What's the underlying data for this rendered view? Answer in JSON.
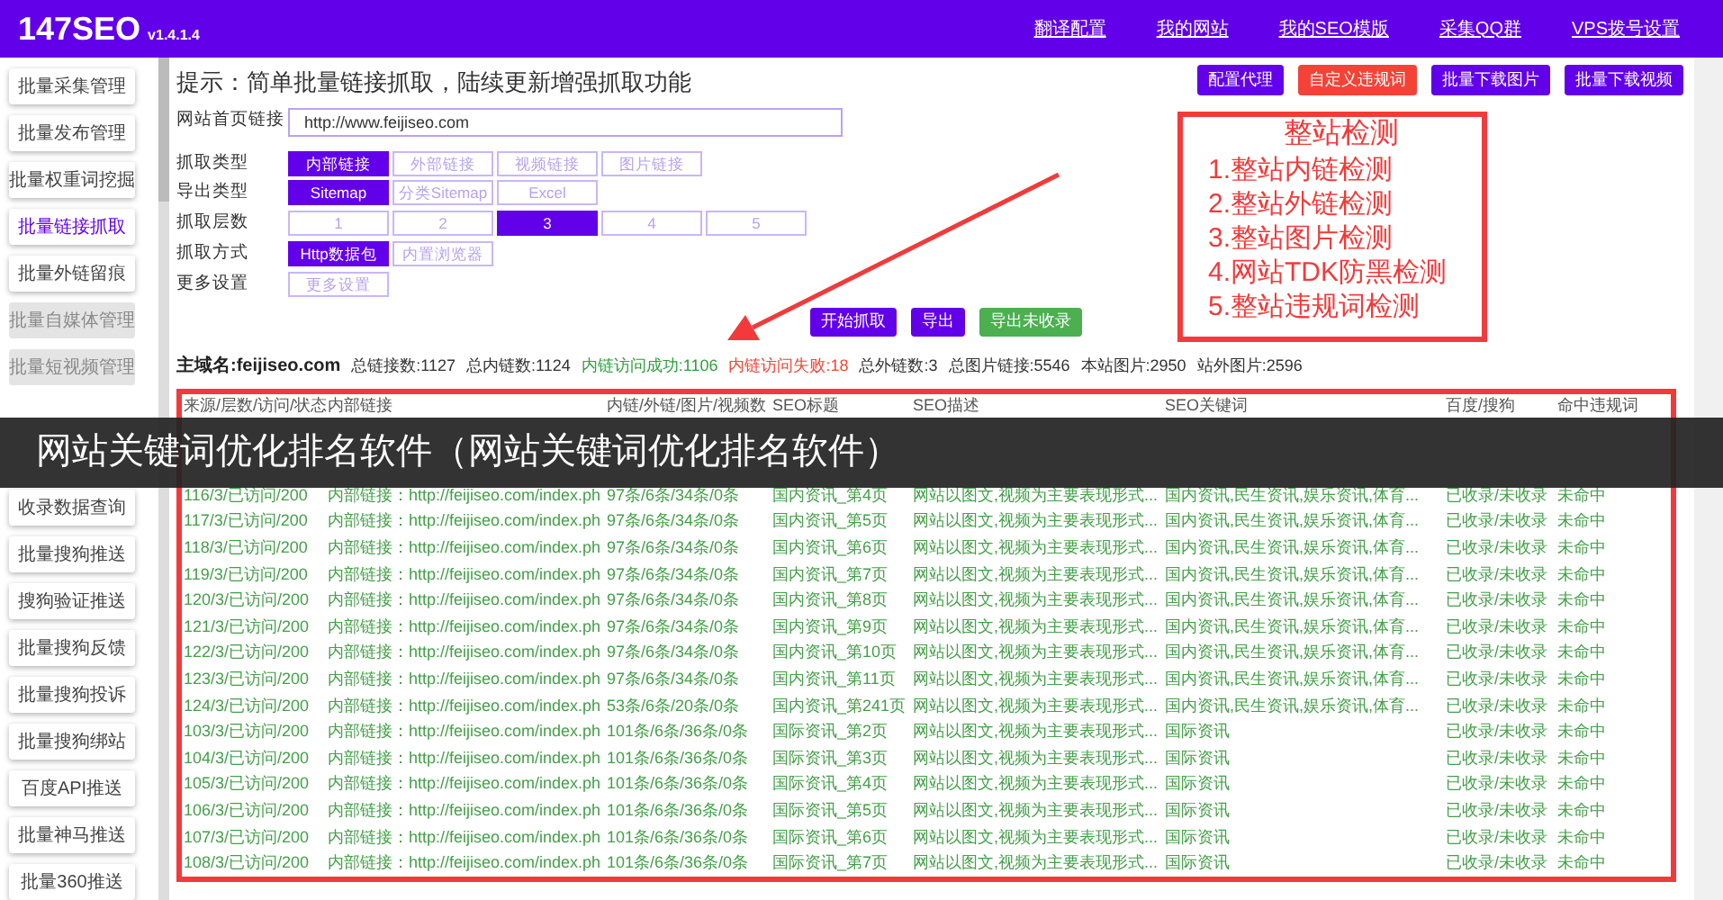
{
  "app": {
    "logo": "147SEO",
    "version": "v1.4.1.4"
  },
  "top_nav": [
    "翻译配置",
    "我的网站",
    "我的SEO模版",
    "采集QQ群",
    "VPS拨号设置"
  ],
  "sidebar": {
    "items": [
      {
        "label": "批量采集管理",
        "selected": false,
        "disabled": false
      },
      {
        "label": "批量发布管理",
        "selected": false,
        "disabled": false
      },
      {
        "label": "批量权重词挖掘",
        "selected": false,
        "disabled": false
      },
      {
        "label": "批量链接抓取",
        "selected": true,
        "disabled": false
      },
      {
        "label": "批量外链留痕",
        "selected": false,
        "disabled": false
      },
      {
        "label": "批量自媒体管理",
        "selected": false,
        "disabled": true
      },
      {
        "label": "批量短视频管理",
        "selected": false,
        "disabled": true
      },
      {
        "label": "收录数据查询",
        "selected": false,
        "disabled": false
      },
      {
        "label": "批量搜狗推送",
        "selected": false,
        "disabled": false
      },
      {
        "label": "搜狗验证推送",
        "selected": false,
        "disabled": false
      },
      {
        "label": "批量搜狗反馈",
        "selected": false,
        "disabled": false
      },
      {
        "label": "批量搜狗投诉",
        "selected": false,
        "disabled": false
      },
      {
        "label": "批量搜狗绑站",
        "selected": false,
        "disabled": false
      },
      {
        "label": "百度API推送",
        "selected": false,
        "disabled": false
      },
      {
        "label": "批量神马推送",
        "selected": false,
        "disabled": false
      },
      {
        "label": "批量360推送",
        "selected": false,
        "disabled": false
      }
    ]
  },
  "hint": "提示：简单批量链接抓取，陆续更新增强抓取功能",
  "tool_buttons": [
    {
      "label": "配置代理",
      "kind": "primary"
    },
    {
      "label": "自定义违规词",
      "kind": "danger"
    },
    {
      "label": "批量下载图片",
      "kind": "primary"
    },
    {
      "label": "批量下载视频",
      "kind": "primary"
    }
  ],
  "url_field": {
    "label": "网站首页链接",
    "value": "http://www.feijiseo.com"
  },
  "option_rows": [
    {
      "label": "抓取类型",
      "options": [
        {
          "label": "内部链接",
          "selected": true
        },
        {
          "label": "外部链接",
          "selected": false
        },
        {
          "label": "视频链接",
          "selected": false
        },
        {
          "label": "图片链接",
          "selected": false
        }
      ]
    },
    {
      "label": "导出类型",
      "options": [
        {
          "label": "Sitemap",
          "selected": true
        },
        {
          "label": "分类Sitemap",
          "selected": false
        },
        {
          "label": "Excel",
          "selected": false
        }
      ]
    },
    {
      "label": "抓取层数",
      "options": [
        {
          "label": "1",
          "selected": false
        },
        {
          "label": "2",
          "selected": false
        },
        {
          "label": "3",
          "selected": true
        },
        {
          "label": "4",
          "selected": false
        },
        {
          "label": "5",
          "selected": false
        }
      ]
    },
    {
      "label": "抓取方式",
      "options": [
        {
          "label": "Http数据包",
          "selected": true
        },
        {
          "label": "内置浏览器",
          "selected": false
        }
      ]
    },
    {
      "label": "更多设置",
      "options": [
        {
          "label": "更多设置",
          "selected": false
        }
      ]
    }
  ],
  "action_buttons": [
    {
      "label": "开始抓取",
      "kind": "primary"
    },
    {
      "label": "导出",
      "kind": "primary"
    },
    {
      "label": "导出未收录",
      "kind": "success"
    }
  ],
  "stats": [
    {
      "text": "主域名:feijiseo.com",
      "kind": "domain"
    },
    {
      "text": "总链接数:1127",
      "kind": "plain"
    },
    {
      "text": "总内链数:1124",
      "kind": "plain"
    },
    {
      "text": "内链访问成功:1106",
      "kind": "success"
    },
    {
      "text": "内链访问失败:18",
      "kind": "fail"
    },
    {
      "text": "总外链数:3",
      "kind": "plain"
    },
    {
      "text": "总图片链接:5546",
      "kind": "plain"
    },
    {
      "text": "本站图片:2950",
      "kind": "plain"
    },
    {
      "text": "站外图片:2596",
      "kind": "plain"
    }
  ],
  "annotation": {
    "title": "整站检测",
    "lines": [
      "1.整站内链检测",
      "2.整站外链检测",
      "3.整站图片检测",
      "4.网站TDK防黑检测",
      "5.整站违规词检测"
    ]
  },
  "table": {
    "columns": [
      "来源/层数/访问/状态",
      "内部链接",
      "内链/外链/图片/视频数",
      "SEO标题",
      "SEO描述",
      "SEO关键词",
      "百度/搜狗",
      "命中违规词"
    ],
    "rows": [
      [
        "116/3/已访问/200",
        "内部链接：http://feijiseo.com/index.ph",
        "97条/6条/34条/0条",
        "国内资讯_第4页",
        "网站以图文,视频为主要表现形式...",
        "国内资讯,民生资讯,娱乐资讯,体育...",
        "已收录/未收录",
        "未命中"
      ],
      [
        "117/3/已访问/200",
        "内部链接：http://feijiseo.com/index.ph",
        "97条/6条/34条/0条",
        "国内资讯_第5页",
        "网站以图文,视频为主要表现形式...",
        "国内资讯,民生资讯,娱乐资讯,体育...",
        "已收录/未收录",
        "未命中"
      ],
      [
        "118/3/已访问/200",
        "内部链接：http://feijiseo.com/index.ph",
        "97条/6条/34条/0条",
        "国内资讯_第6页",
        "网站以图文,视频为主要表现形式...",
        "国内资讯,民生资讯,娱乐资讯,体育...",
        "已收录/未收录",
        "未命中"
      ],
      [
        "119/3/已访问/200",
        "内部链接：http://feijiseo.com/index.ph",
        "97条/6条/34条/0条",
        "国内资讯_第7页",
        "网站以图文,视频为主要表现形式...",
        "国内资讯,民生资讯,娱乐资讯,体育...",
        "已收录/未收录",
        "未命中"
      ],
      [
        "120/3/已访问/200",
        "内部链接：http://feijiseo.com/index.ph",
        "97条/6条/34条/0条",
        "国内资讯_第8页",
        "网站以图文,视频为主要表现形式...",
        "国内资讯,民生资讯,娱乐资讯,体育...",
        "已收录/未收录",
        "未命中"
      ],
      [
        "121/3/已访问/200",
        "内部链接：http://feijiseo.com/index.ph",
        "97条/6条/34条/0条",
        "国内资讯_第9页",
        "网站以图文,视频为主要表现形式...",
        "国内资讯,民生资讯,娱乐资讯,体育...",
        "已收录/未收录",
        "未命中"
      ],
      [
        "122/3/已访问/200",
        "内部链接：http://feijiseo.com/index.ph",
        "97条/6条/34条/0条",
        "国内资讯_第10页",
        "网站以图文,视频为主要表现形式...",
        "国内资讯,民生资讯,娱乐资讯,体育...",
        "已收录/未收录",
        "未命中"
      ],
      [
        "123/3/已访问/200",
        "内部链接：http://feijiseo.com/index.ph",
        "97条/6条/34条/0条",
        "国内资讯_第11页",
        "网站以图文,视频为主要表现形式...",
        "国内资讯,民生资讯,娱乐资讯,体育...",
        "已收录/未收录",
        "未命中"
      ],
      [
        "124/3/已访问/200",
        "内部链接：http://feijiseo.com/index.ph",
        "53条/6条/20条/0条",
        "国内资讯_第241页",
        "网站以图文,视频为主要表现形式...",
        "国内资讯,民生资讯,娱乐资讯,体育...",
        "已收录/未收录",
        "未命中"
      ],
      [
        "103/3/已访问/200",
        "内部链接：http://feijiseo.com/index.ph",
        "101条/6条/36条/0条",
        "国际资讯_第2页",
        "网站以图文,视频为主要表现形式...",
        "国际资讯",
        "已收录/未收录",
        "未命中"
      ],
      [
        "104/3/已访问/200",
        "内部链接：http://feijiseo.com/index.ph",
        "101条/6条/36条/0条",
        "国际资讯_第3页",
        "网站以图文,视频为主要表现形式...",
        "国际资讯",
        "已收录/未收录",
        "未命中"
      ],
      [
        "105/3/已访问/200",
        "内部链接：http://feijiseo.com/index.ph",
        "101条/6条/36条/0条",
        "国际资讯_第4页",
        "网站以图文,视频为主要表现形式...",
        "国际资讯",
        "已收录/未收录",
        "未命中"
      ],
      [
        "106/3/已访问/200",
        "内部链接：http://feijiseo.com/index.ph",
        "101条/6条/36条/0条",
        "国际资讯_第5页",
        "网站以图文,视频为主要表现形式...",
        "国际资讯",
        "已收录/未收录",
        "未命中"
      ],
      [
        "107/3/已访问/200",
        "内部链接：http://feijiseo.com/index.ph",
        "101条/6条/36条/0条",
        "国际资讯_第6页",
        "网站以图文,视频为主要表现形式...",
        "国际资讯",
        "已收录/未收录",
        "未命中"
      ],
      [
        "108/3/已访问/200",
        "内部链接：http://feijiseo.com/index.ph",
        "101条/6条/36条/0条",
        "国际资讯_第7页",
        "网站以图文,视频为主要表现形式...",
        "国际资讯",
        "已收录/未收录",
        "未命中"
      ]
    ]
  },
  "caption_banner": "网站关键词优化排名软件（网站关键词优化排名软件）"
}
